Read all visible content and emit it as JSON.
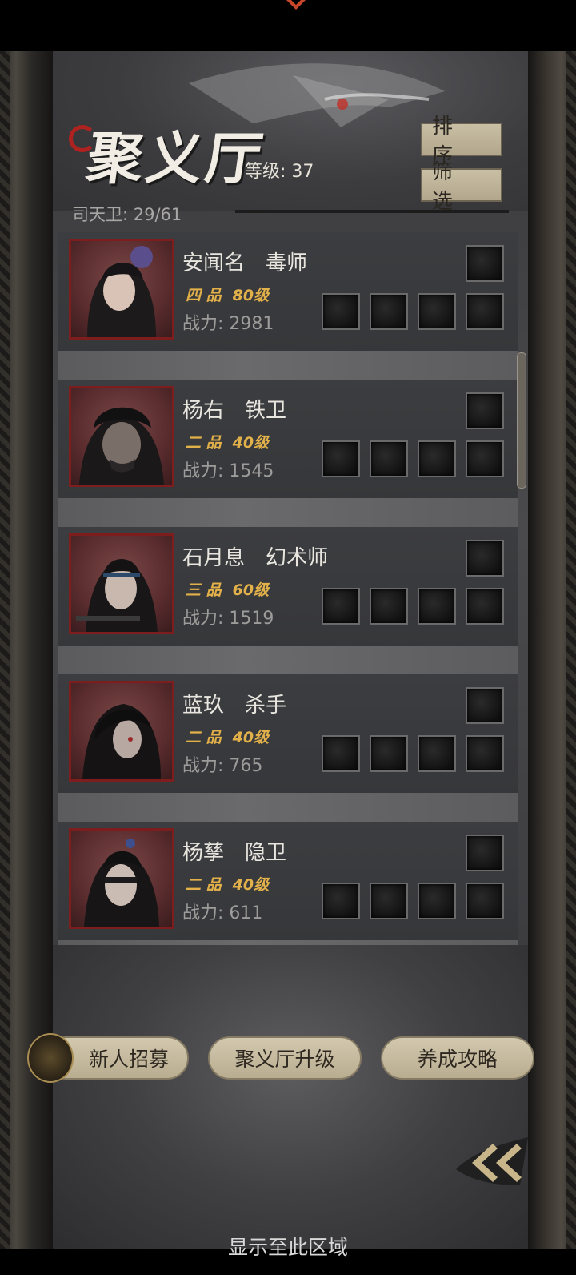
{
  "header": {
    "title": "聚义厅",
    "level_label": "等级: 37",
    "guards_label": "司天卫: 29/61"
  },
  "controls": {
    "sort_label": "排 序",
    "filter_label": "筛 选"
  },
  "heroes": [
    {
      "name": "安闻名　毒师",
      "rank": "四 品",
      "level": "80级",
      "power": "战力: 2981"
    },
    {
      "name": "杨右　铁卫",
      "rank": "二 品",
      "level": "40级",
      "power": "战力: 1545"
    },
    {
      "name": "石月息　幻术师",
      "rank": "三 品",
      "level": "60级",
      "power": "战力: 1519"
    },
    {
      "name": "蓝玖　杀手",
      "rank": "二 品",
      "level": "40级",
      "power": "战力: 765"
    },
    {
      "name": "杨孳　隐卫",
      "rank": "二 品",
      "level": "40级",
      "power": "战力: 611"
    }
  ],
  "bottom_buttons": {
    "recruit": "新人招募",
    "upgrade": "聚义厅升级",
    "guide": "养成攻略"
  },
  "footer": {
    "display_text": "显示至此区域"
  },
  "colors": {
    "rank_gold": "#e3b14a",
    "portrait_border": "#7d1d1d",
    "button_beige": "#c9bfa5"
  },
  "icons": [
    "logo-icon",
    "recruit-token-icon",
    "back-double-chevron-icon",
    "equipment-slot-icon"
  ]
}
